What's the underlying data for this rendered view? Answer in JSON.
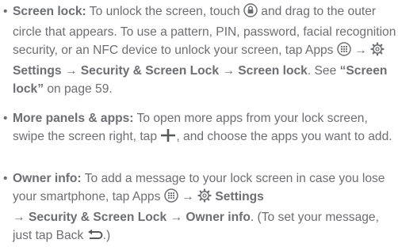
{
  "items": [
    {
      "bullet": "•",
      "heading": "Screen lock:",
      "t1": " To unlock the screen, touch ",
      "t2": " and drag to the outer circle that appears. To use a pattern, PIN, password, facial recognition security, or an NFC device to unlock your screen, tap Apps ",
      "arrow1": " → ",
      "settings": "Settings",
      "arrow2": " → ",
      "security": "Security & Screen Lock",
      "arrow3": " → ",
      "screen_lock": "Screen lock",
      "t3": ". See ",
      "quote_open": "“",
      "ref": "Screen lock",
      "quote_close": "”",
      "t4": " on page 59."
    },
    {
      "bullet": "•",
      "heading": "More panels & apps:",
      "t1": " To open more apps from your lock screen, swipe the screen right, tap ",
      "t2": ", and choose the apps you want to add."
    },
    {
      "bullet": "•",
      "heading": "Owner info:",
      "t1": " To add a message to your lock screen in case you lose your smartphone, tap Apps ",
      "arrow1": " → ",
      "settings": "Settings",
      "arrow2": " → ",
      "security": "Security & Screen Lock",
      "arrow3": " → ",
      "owner_info": "Owner info",
      "t3": ". (To set your message, just tap Back ",
      "t4": ".)"
    }
  ],
  "icons": {
    "lock": "lock-icon",
    "apps": "apps-icon",
    "settings": "gear-icon",
    "plus": "plus-icon",
    "back": "back-arrow-icon"
  },
  "colors": {
    "text": "#6d6e71",
    "emphasis": "#58595b"
  }
}
